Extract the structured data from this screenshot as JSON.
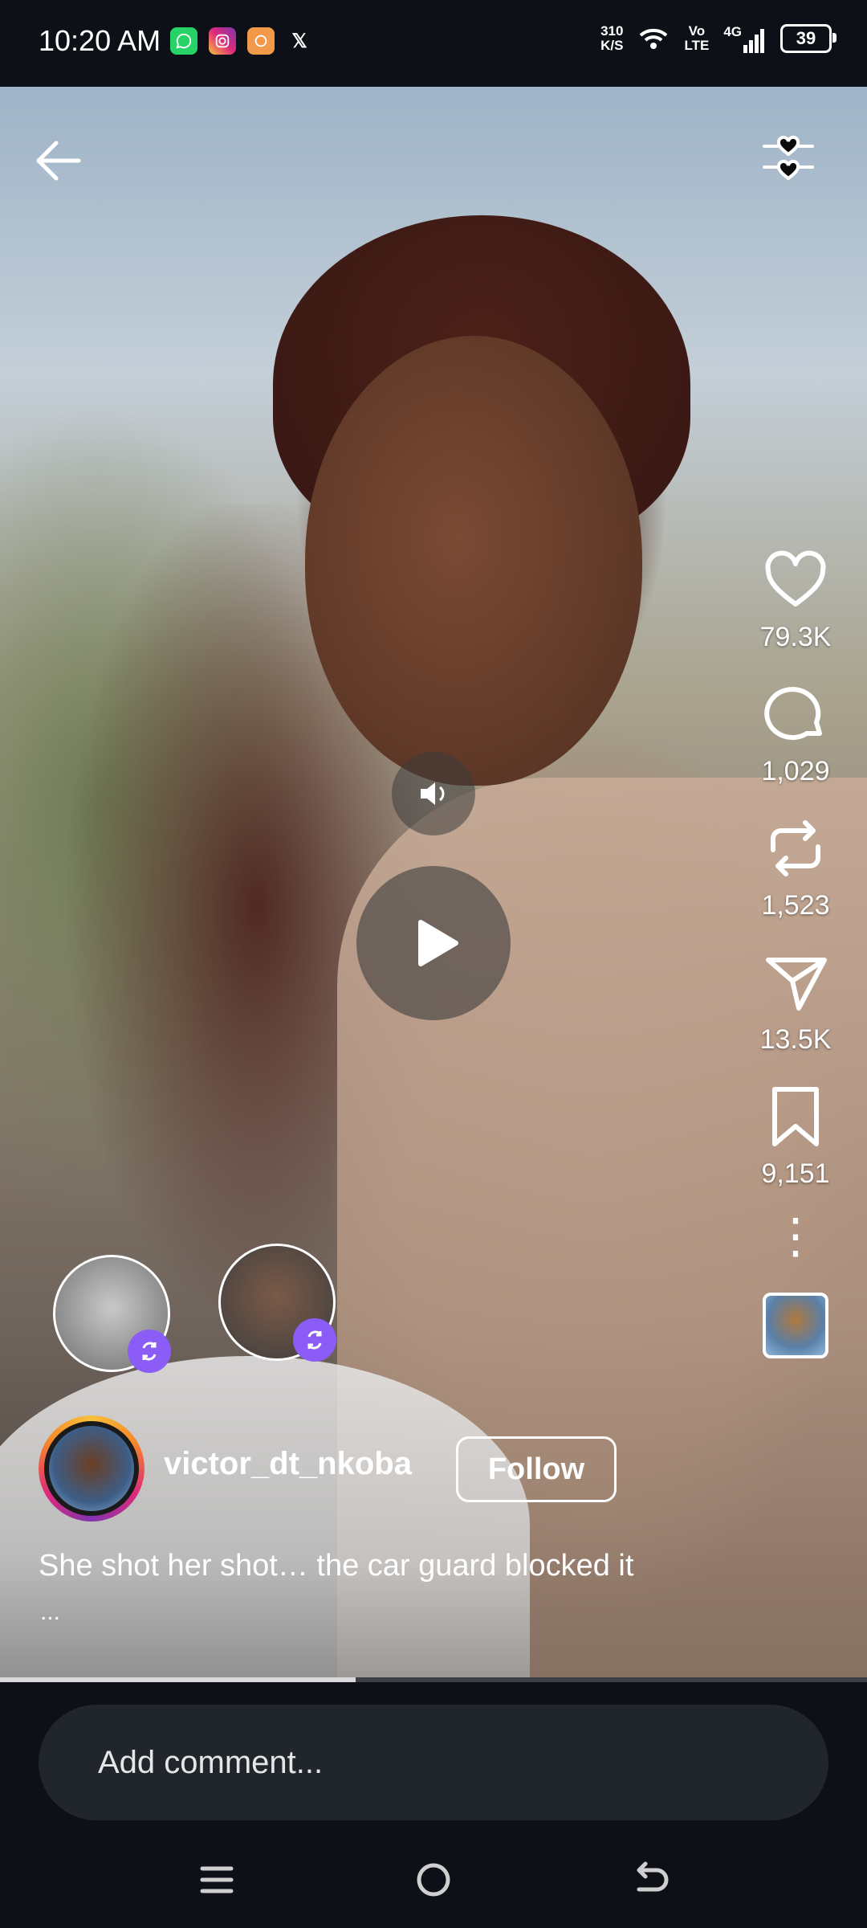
{
  "status_bar": {
    "time": "10:20 AM",
    "net_speed_value": "310",
    "net_speed_unit": "K/S",
    "volte_top": "Vo",
    "volte_bottom": "LTE",
    "network": "4G",
    "battery": "39",
    "app_icons": [
      "whatsapp-icon",
      "instagram-icon",
      "app-icon",
      "x-icon"
    ]
  },
  "reel": {
    "actions": {
      "likes": "79.3K",
      "comments": "1,029",
      "reposts": "1,523",
      "shares": "13.5K",
      "saves": "9,151"
    },
    "username": "victor_dt_nkoba",
    "follow_label": "Follow",
    "caption": "She shot her shot… the car guard blocked it",
    "caption_more": "...",
    "progress": 0.41
  },
  "comment": {
    "placeholder": "Add comment..."
  },
  "colors": {
    "background": "#0d1117",
    "repost_badge": "#8b5cf6",
    "input_bg": "#21262d"
  }
}
